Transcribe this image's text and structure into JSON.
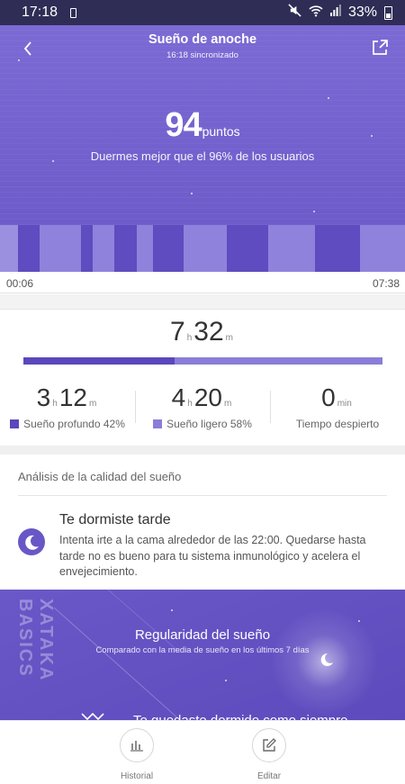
{
  "status_bar": {
    "time": "17:18",
    "battery": "33%"
  },
  "header": {
    "title": "Sueño de anoche",
    "sync_status": "16:18 sincronizado"
  },
  "score": {
    "value": "94",
    "unit": "puntos",
    "description": "Duermes mejor que el 96% de los usuarios"
  },
  "timeline": {
    "start": "00:06",
    "end": "07:38",
    "legend_colors": {
      "deep": "#5e4cc0",
      "light": "#8f82dc",
      "awake": "#aaa0e6"
    }
  },
  "total": {
    "hours": "7",
    "hours_unit": "h",
    "minutes": "32",
    "minutes_unit": "m"
  },
  "breakdown": {
    "deep_fraction": 0.42,
    "deep": {
      "hours": "3",
      "hours_unit": "h",
      "minutes": "12",
      "minutes_unit": "m",
      "label": "Sueño profundo 42%",
      "color": "#5a48bc"
    },
    "light": {
      "hours": "4",
      "hours_unit": "h",
      "minutes": "20",
      "minutes_unit": "m",
      "label": "Sueño ligero 58%",
      "color": "#8a7dd8"
    },
    "awake": {
      "value": "0",
      "unit": "min",
      "label": "Tiempo despierto"
    }
  },
  "analysis": {
    "heading": "Análisis de la calidad del sueño",
    "tip_title": "Te dormiste tarde",
    "tip_text": "Intenta irte a la cama alrededor de las 22:00. Quedarse hasta tarde no es bueno para tu sistema inmunológico y acelera el envejecimiento."
  },
  "regularity": {
    "title": "Regularidad del sueño",
    "subtitle": "Comparado con la media de sueño en los últimos 7 días",
    "watermark": "XATAKA BASICS",
    "next_text": "Te quedaste dormido como siempre"
  },
  "nav": {
    "history_label": "Historial",
    "edit_label": "Editar"
  }
}
